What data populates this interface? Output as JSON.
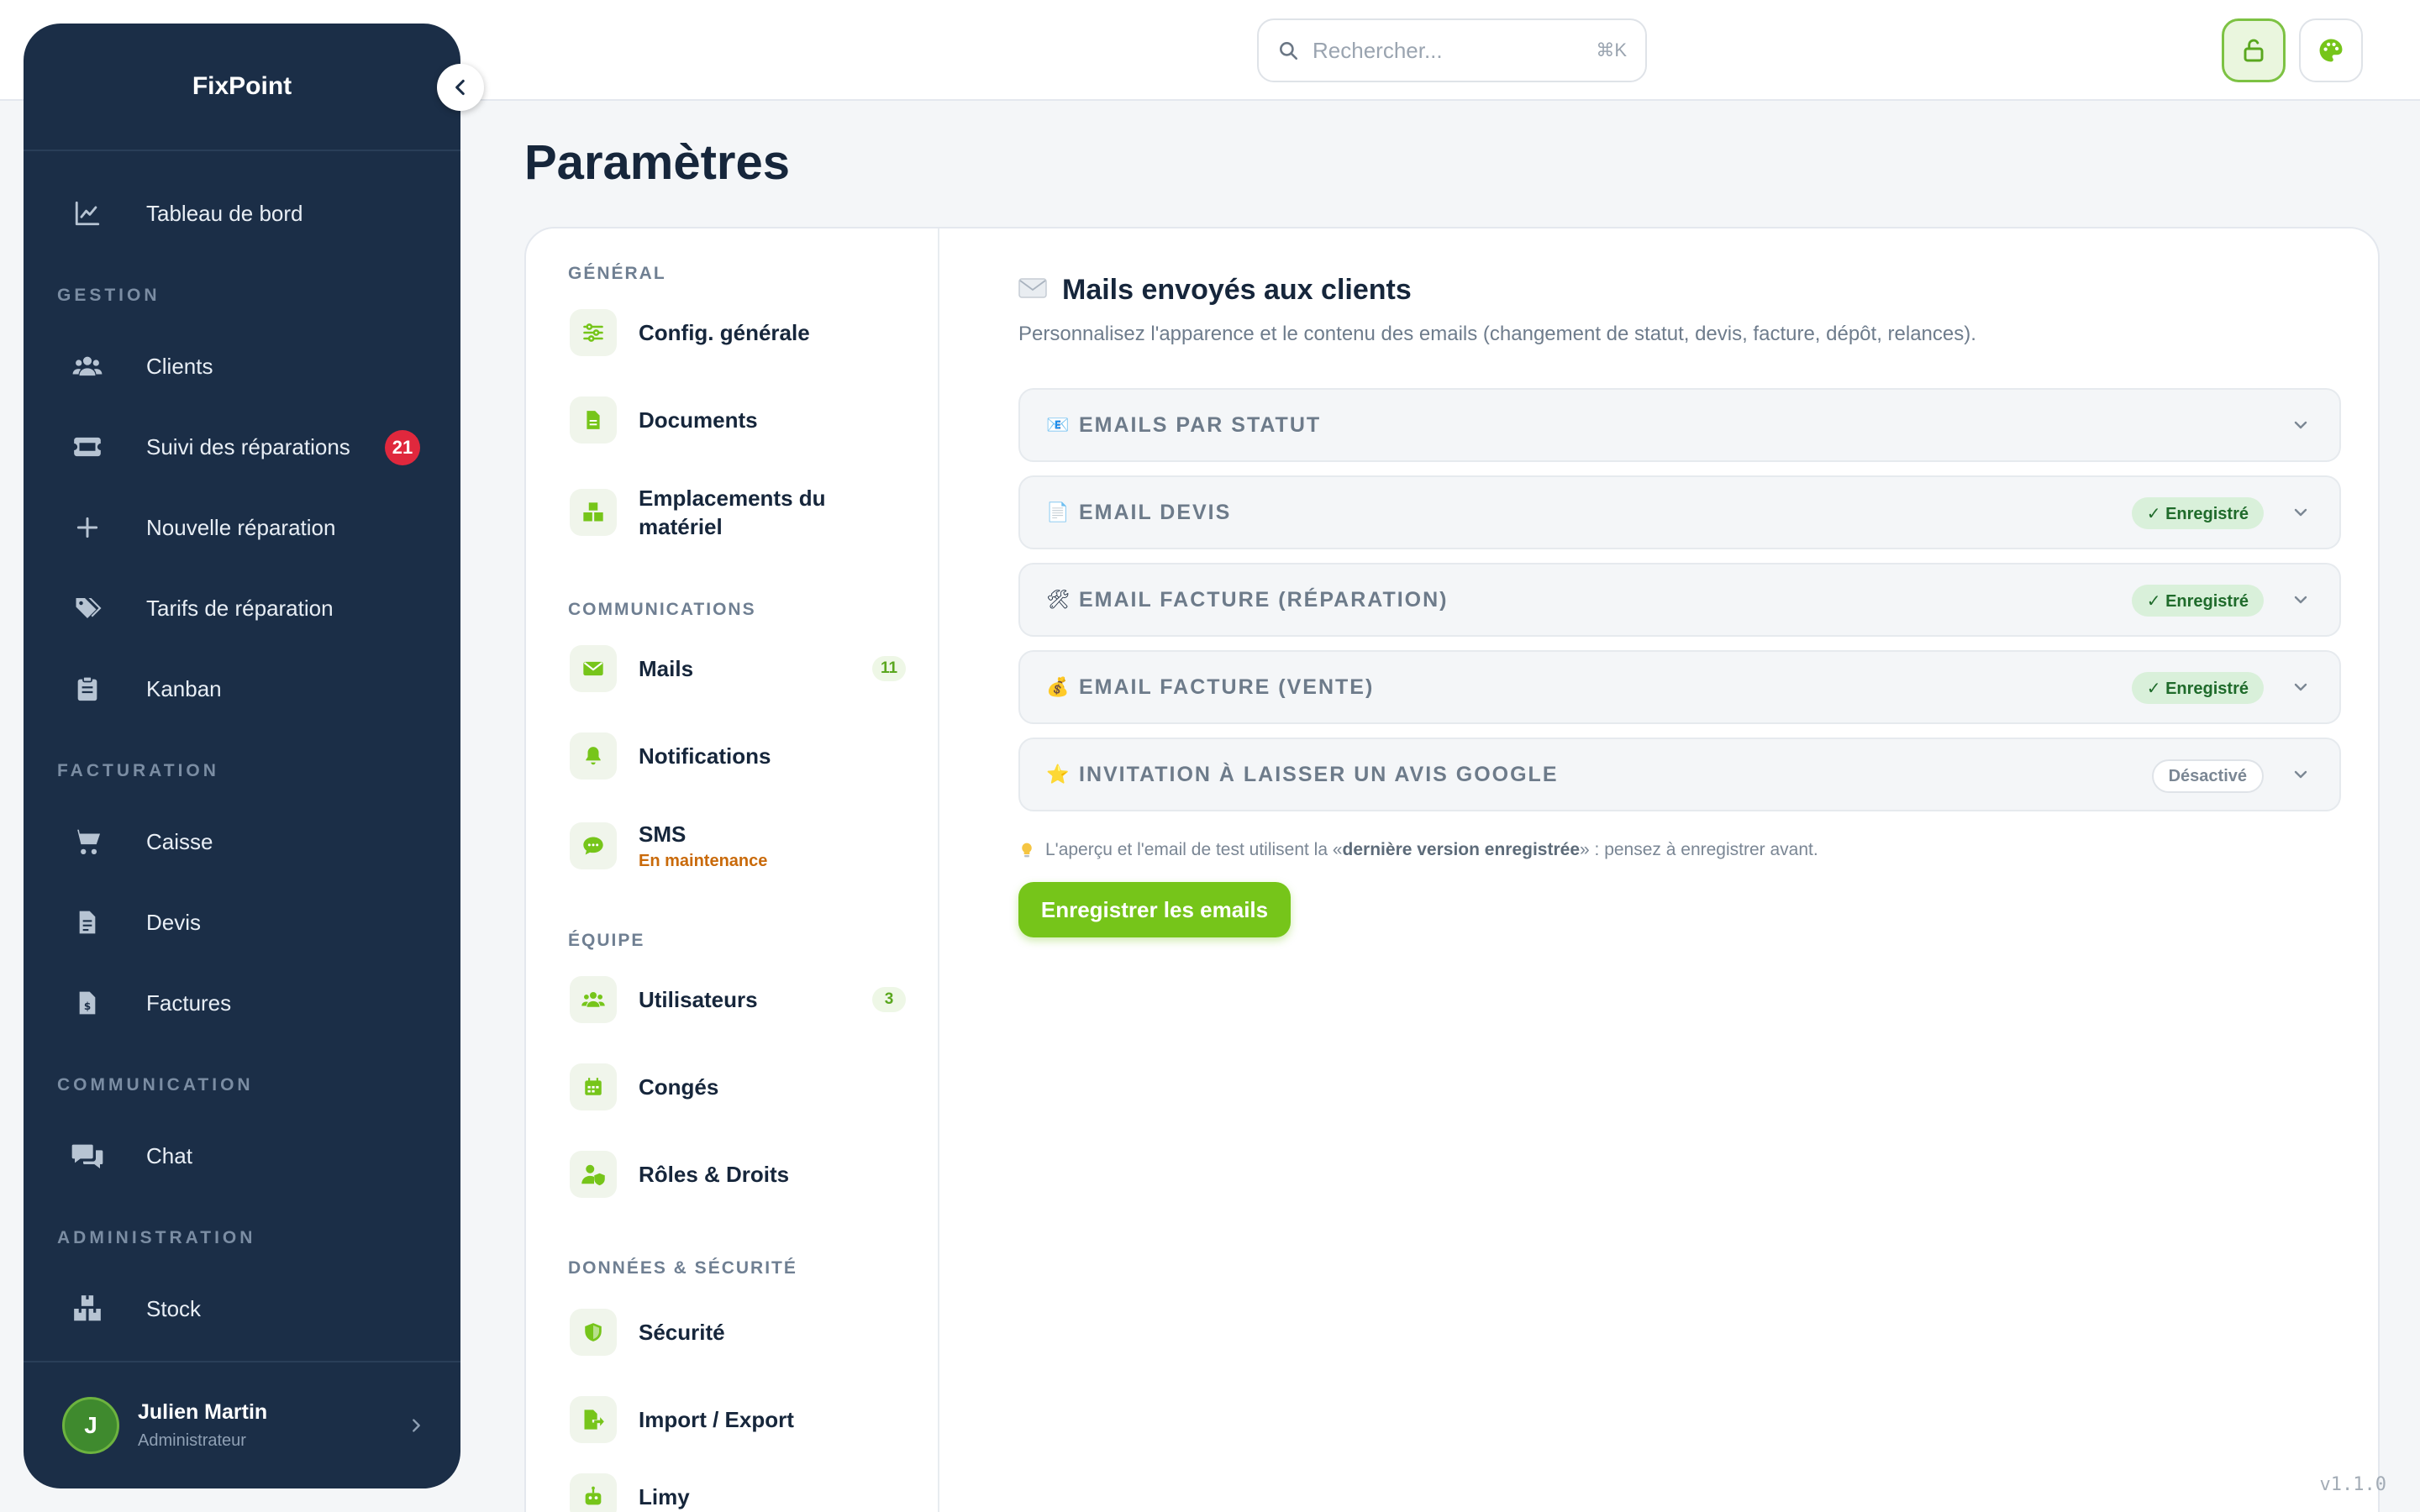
{
  "app": {
    "brand": "FixPoint",
    "version": "v1.1.0"
  },
  "search": {
    "placeholder": "Rechercher...",
    "shortcut": "⌘K"
  },
  "sidebar": {
    "items": [
      {
        "label": "Tableau de bord",
        "icon": "chart-line-icon"
      },
      {
        "section": "GESTION"
      },
      {
        "label": "Clients",
        "icon": "users-icon"
      },
      {
        "label": "Suivi des réparations",
        "icon": "ticket-icon",
        "badge": "21"
      },
      {
        "label": "Nouvelle réparation",
        "icon": "plus-icon"
      },
      {
        "label": "Tarifs de réparation",
        "icon": "tags-icon"
      },
      {
        "label": "Kanban",
        "icon": "clipboard-icon"
      },
      {
        "section": "FACTURATION"
      },
      {
        "label": "Caisse",
        "icon": "cart-icon"
      },
      {
        "label": "Devis",
        "icon": "file-icon"
      },
      {
        "label": "Factures",
        "icon": "invoice-icon"
      },
      {
        "section": "COMMUNICATION"
      },
      {
        "label": "Chat",
        "icon": "chat-icon"
      },
      {
        "section": "ADMINISTRATION"
      },
      {
        "label": "Stock",
        "icon": "boxes-icon"
      }
    ],
    "user": {
      "initial": "J",
      "name": "Julien Martin",
      "role": "Administrateur"
    }
  },
  "page": {
    "title": "Paramètres"
  },
  "settings_nav": {
    "sections": [
      "GÉNÉRAL",
      "COMMUNICATIONS",
      "ÉQUIPE",
      "DONNÉES & SÉCURITÉ"
    ],
    "items": [
      {
        "label": "Config. générale",
        "icon": "sliders-icon"
      },
      {
        "label": "Documents",
        "icon": "document-icon"
      },
      {
        "label": "Emplacements du matériel",
        "icon": "boxes-icon"
      },
      {
        "label": "Mails",
        "icon": "envelope-icon",
        "count": "11"
      },
      {
        "label": "Notifications",
        "icon": "bell-icon"
      },
      {
        "label": "SMS",
        "icon": "sms-icon",
        "sub": "En maintenance"
      },
      {
        "label": "Utilisateurs",
        "icon": "users-icon",
        "count": "3"
      },
      {
        "label": "Congés",
        "icon": "calendar-icon"
      },
      {
        "label": "Rôles & Droits",
        "icon": "user-shield-icon"
      },
      {
        "label": "Sécurité",
        "icon": "shield-icon"
      },
      {
        "label": "Import / Export",
        "icon": "file-export-icon"
      },
      {
        "label": "Limy",
        "icon": "robot-icon"
      }
    ]
  },
  "mails": {
    "title": "Mails envoyés aux clients",
    "description": "Personnalisez l'apparence et le contenu des emails (changement de statut, devis, facture, dépôt, relances).",
    "sections": [
      {
        "emoji": "📧",
        "label": "EMAILS PAR STATUT",
        "status": ""
      },
      {
        "emoji": "📄",
        "label": "EMAIL DEVIS",
        "status": "✓ Enregistré"
      },
      {
        "emoji": "🛠",
        "label": "EMAIL FACTURE (RÉPARATION)",
        "status": "✓ Enregistré"
      },
      {
        "emoji": "💰",
        "label": "EMAIL FACTURE (VENTE)",
        "status": "✓ Enregistré"
      },
      {
        "emoji": "⭐",
        "label": "INVITATION À LAISSER UN AVIS GOOGLE",
        "status": "Désactivé"
      }
    ],
    "hint_before": "L'aperçu et l'email de test utilisent la « ",
    "hint_bold": "dernière version enregistrée",
    "hint_after": " » : pensez à enregistrer avant.",
    "save_label": "Enregistrer les emails"
  },
  "colors": {
    "sidebar": "#1b2e47",
    "accent": "#76c51a",
    "badge": "#e0283d",
    "success_bg": "#d9f0da",
    "warning_text": "#c96a0a"
  }
}
